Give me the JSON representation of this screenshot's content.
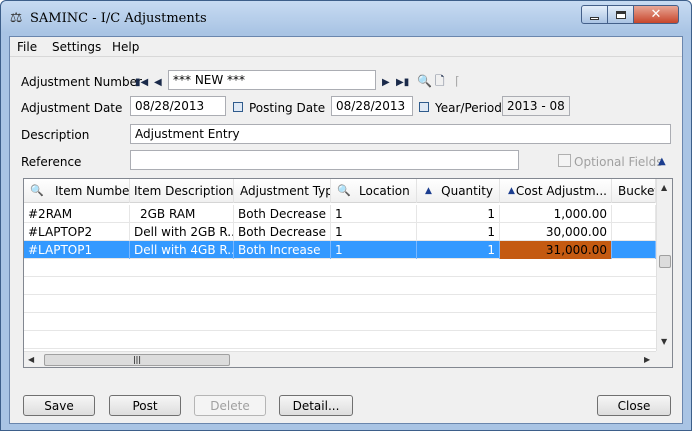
{
  "window": {
    "title": "SAMINC - I/C Adjustments",
    "icon": "scales-icon"
  },
  "menu": [
    "File",
    "Settings",
    "Help"
  ],
  "form": {
    "adjustment_number_label": "Adjustment Number",
    "adjustment_number_value": "*** NEW ***",
    "adjustment_date_label": "Adjustment Date",
    "adjustment_date_value": "08/28/2013",
    "posting_date_label": "Posting Date",
    "posting_date_value": "08/28/2013",
    "year_period_label": "Year/Period",
    "year_period_value": "2013 - 08",
    "description_label": "Description",
    "description_value": "Adjustment Entry",
    "reference_label": "Reference",
    "reference_value": "",
    "optional_fields_label": "Optional Fields"
  },
  "grid": {
    "columns": [
      "Item Number",
      "Item Description",
      "Adjustment Type",
      "Location",
      "Quantity",
      "Cost Adjustm...",
      "Bucket"
    ],
    "rows": [
      {
        "item_number": "#2RAM",
        "item_description": "2GB RAM",
        "adjustment_type": "Both Decrease",
        "location": "1",
        "quantity": "1",
        "cost_adjustment": "1,000.00"
      },
      {
        "item_number": "#LAPTOP2",
        "item_description": "Dell with 2GB R...",
        "adjustment_type": "Both Decrease",
        "location": "1",
        "quantity": "1",
        "cost_adjustment": "30,000.00"
      },
      {
        "item_number": "#LAPTOP1",
        "item_description": "Dell with 4GB R...",
        "adjustment_type": "Both Increase",
        "location": "1",
        "quantity": "1",
        "cost_adjustment": "31,000.00"
      }
    ],
    "selected_row": 2
  },
  "buttons": {
    "save": "Save",
    "post": "Post",
    "delete": "Delete",
    "detail": "Detail...",
    "close": "Close"
  },
  "colors": {
    "selection": "#3399ff",
    "highlight_cell": "#c45a11",
    "title_gradient_top": "#c7dbf2",
    "title_gradient_bottom": "#a9c4e4"
  }
}
